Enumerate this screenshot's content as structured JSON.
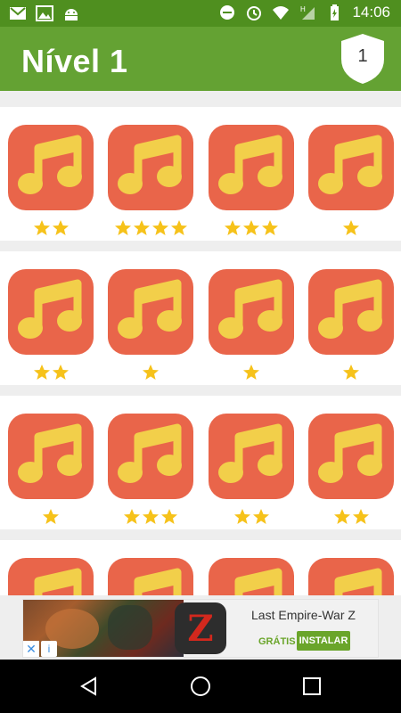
{
  "status_bar": {
    "time": "14:06",
    "left_icons": [
      "gmail-icon",
      "image-icon",
      "android-icon"
    ],
    "right_icons": [
      "minus-circle-icon",
      "alarm-icon",
      "wifi-icon",
      "signal-h-icon",
      "battery-charging-icon"
    ]
  },
  "header": {
    "title": "Nível 1",
    "badge_number": "1"
  },
  "levels": [
    [
      {
        "stars": 2
      },
      {
        "stars": 4
      },
      {
        "stars": 3
      },
      {
        "stars": 1
      }
    ],
    [
      {
        "stars": 2
      },
      {
        "stars": 1
      },
      {
        "stars": 1
      },
      {
        "stars": 1
      }
    ],
    [
      {
        "stars": 1
      },
      {
        "stars": 3
      },
      {
        "stars": 2
      },
      {
        "stars": 2
      }
    ],
    [
      {
        "stars": 0
      },
      {
        "stars": 0
      },
      {
        "stars": 0
      },
      {
        "stars": 0
      }
    ]
  ],
  "ad": {
    "title": "Last Empire-War Z",
    "free_label": "GRÁTIS",
    "install_label": "INSTALAR",
    "logo_letter": "Z",
    "close_glyph": "✕",
    "info_glyph": "i"
  },
  "colors": {
    "status_bar": "#4f8f1f",
    "app_bar": "#64a233",
    "tile": "#e9654a",
    "note": "#f2cf4a",
    "star": "#f6c21a"
  }
}
